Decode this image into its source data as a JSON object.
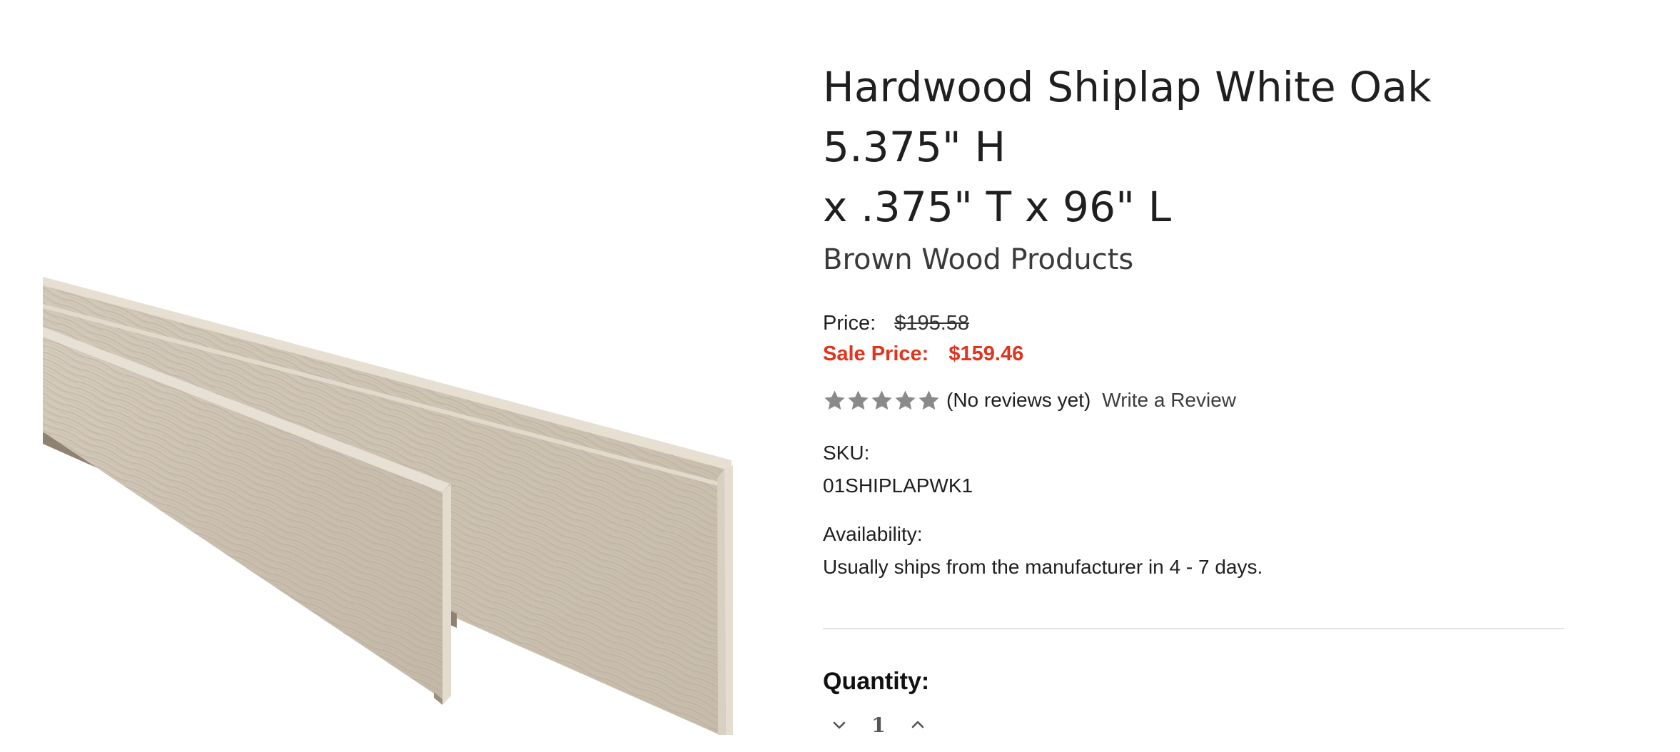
{
  "product": {
    "title_line1": "Hardwood Shiplap White Oak 5.375\" H",
    "title_line2": "x .375\" T x 96\" L",
    "brand": "Brown Wood Products",
    "price_label": "Price:",
    "original_price": "$195.58",
    "sale_label": "Sale Price:",
    "sale_price": "$159.46",
    "rating": {
      "stars": 5,
      "filled": 0,
      "reviews_text": "(No reviews yet)",
      "write_review": "Write a Review"
    },
    "sku_label": "SKU:",
    "sku": "01SHIPLAPWK1",
    "availability_label": "Availability:",
    "availability": "Usually ships from the manufacturer in 4 - 7 days.",
    "quantity_label": "Quantity:",
    "quantity": "1"
  },
  "colors": {
    "sale_red": "#e2331d",
    "star_gray": "#8a8a8a",
    "wood_face": "#cfc5b6",
    "wood_edge": "#e3dbcd",
    "wood_shadow": "#8f8272"
  },
  "icons": {
    "star": "star-icon",
    "decrease": "chevron-down-icon",
    "increase": "chevron-up-icon"
  }
}
